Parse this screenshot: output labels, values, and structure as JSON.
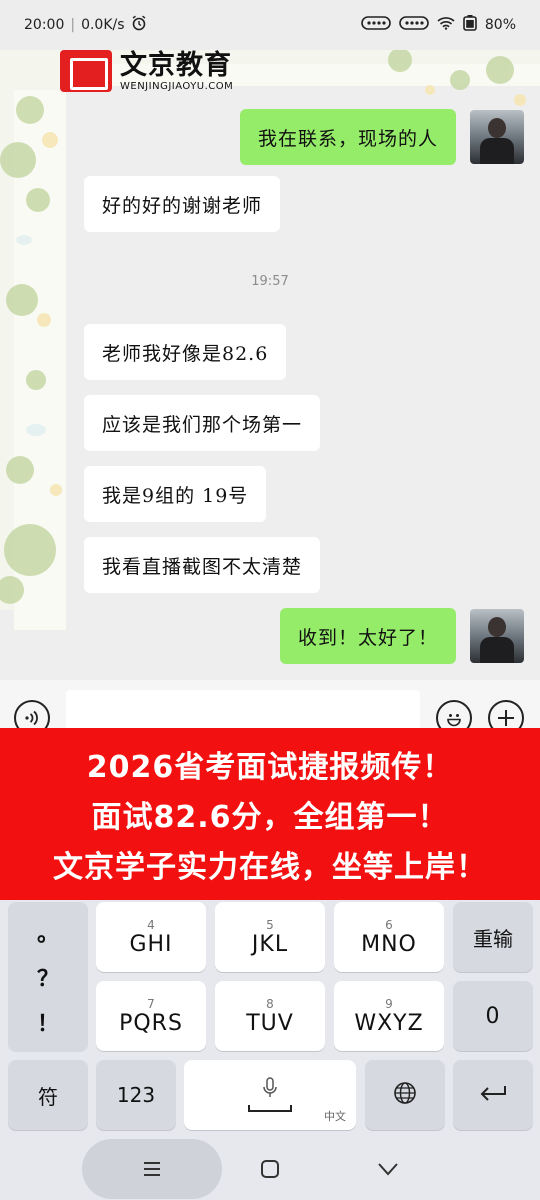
{
  "status_bar": {
    "time": "20:00",
    "net_speed": "0.0K/s",
    "battery": "80%"
  },
  "brand": {
    "name": "文京教育",
    "url": "WENJINGJIAOYU.COM"
  },
  "chat": {
    "messages": [
      {
        "sender": "me",
        "text": "我在联系，现场的人"
      },
      {
        "sender": "other",
        "text": "好的好的谢谢老师"
      },
      {
        "sender": "other",
        "text": "老师我好像是82.6"
      },
      {
        "sender": "other",
        "text": "应该是我们那个场第一"
      },
      {
        "sender": "other",
        "text": "我是9组的 19号"
      },
      {
        "sender": "other",
        "text": "我看直播截图不太清楚"
      },
      {
        "sender": "me",
        "text": "收到！太好了！"
      }
    ],
    "timestamp": "19:57"
  },
  "banner": {
    "line1": "2026省考面试捷报频传！",
    "line2": "面试82.6分，全组第一！",
    "line3": "文京学子实力在线，坐等上岸！"
  },
  "keyboard": {
    "punct": [
      "。",
      "？",
      "！"
    ],
    "row1": [
      {
        "num": "4",
        "letters": "GHI"
      },
      {
        "num": "5",
        "letters": "JKL"
      },
      {
        "num": "6",
        "letters": "MNO"
      }
    ],
    "row2": [
      {
        "num": "7",
        "letters": "PQRS"
      },
      {
        "num": "8",
        "letters": "TUV"
      },
      {
        "num": "9",
        "letters": "WXYZ"
      }
    ],
    "reinput": "重输",
    "zero": "0",
    "symbols": "符",
    "numbers": "123",
    "space_sub": "中文"
  },
  "icons": {
    "alarm": "alarm-icon",
    "wifi": "wifi-icon",
    "voice": "voice-icon",
    "emoji": "emoji-icon",
    "plus": "plus-icon",
    "globe": "globe-icon",
    "enter": "enter-icon",
    "mic": "mic-icon"
  },
  "colors": {
    "my_bubble": "#95ec69",
    "banner": "#f21010",
    "brand_red": "#e3201f"
  }
}
